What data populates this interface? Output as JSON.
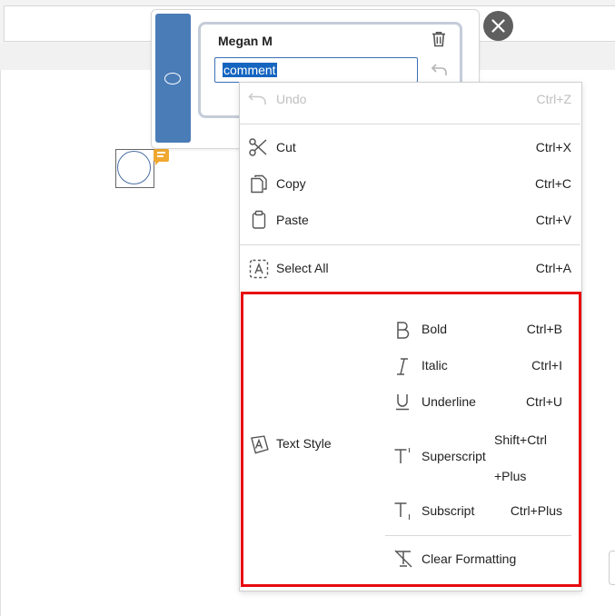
{
  "comment_panel": {
    "author": "Megan M",
    "comment_value": "comment"
  },
  "context_menu": {
    "undo": {
      "label": "Undo",
      "shortcut": "Ctrl+Z"
    },
    "cut": {
      "label": "Cut",
      "shortcut": "Ctrl+X"
    },
    "copy": {
      "label": "Copy",
      "shortcut": "Ctrl+C"
    },
    "paste": {
      "label": "Paste",
      "shortcut": "Ctrl+V"
    },
    "select_all": {
      "label": "Select All",
      "shortcut": "Ctrl+A"
    },
    "text_style": {
      "label": "Text Style"
    },
    "bold": {
      "label": "Bold",
      "shortcut": "Ctrl+B"
    },
    "italic": {
      "label": "Italic",
      "shortcut": "Ctrl+I"
    },
    "underline": {
      "label": "Underline",
      "shortcut": "Ctrl+U"
    },
    "superscript": {
      "label": "Superscript",
      "shortcut_line1": "Shift+Ctrl",
      "shortcut_line2": "+Plus"
    },
    "subscript": {
      "label": "Subscript",
      "shortcut": "Ctrl+Plus"
    },
    "clear_formatting": {
      "label": "Clear Formatting"
    }
  },
  "colors": {
    "highlight_border": "#e8090d",
    "sidebar_accent": "#4a7db7",
    "selection": "#1565c0",
    "comment_badge": "#f0a830"
  },
  "icons": [
    "trash-icon",
    "reply-icon",
    "close-icon",
    "undo-icon",
    "scissors-icon",
    "copy-icon",
    "clipboard-icon",
    "select-all-icon",
    "text-style-icon",
    "bold-icon",
    "italic-icon",
    "underline-icon",
    "superscript-icon",
    "subscript-icon",
    "clear-formatting-icon",
    "comment-badge-icon"
  ]
}
